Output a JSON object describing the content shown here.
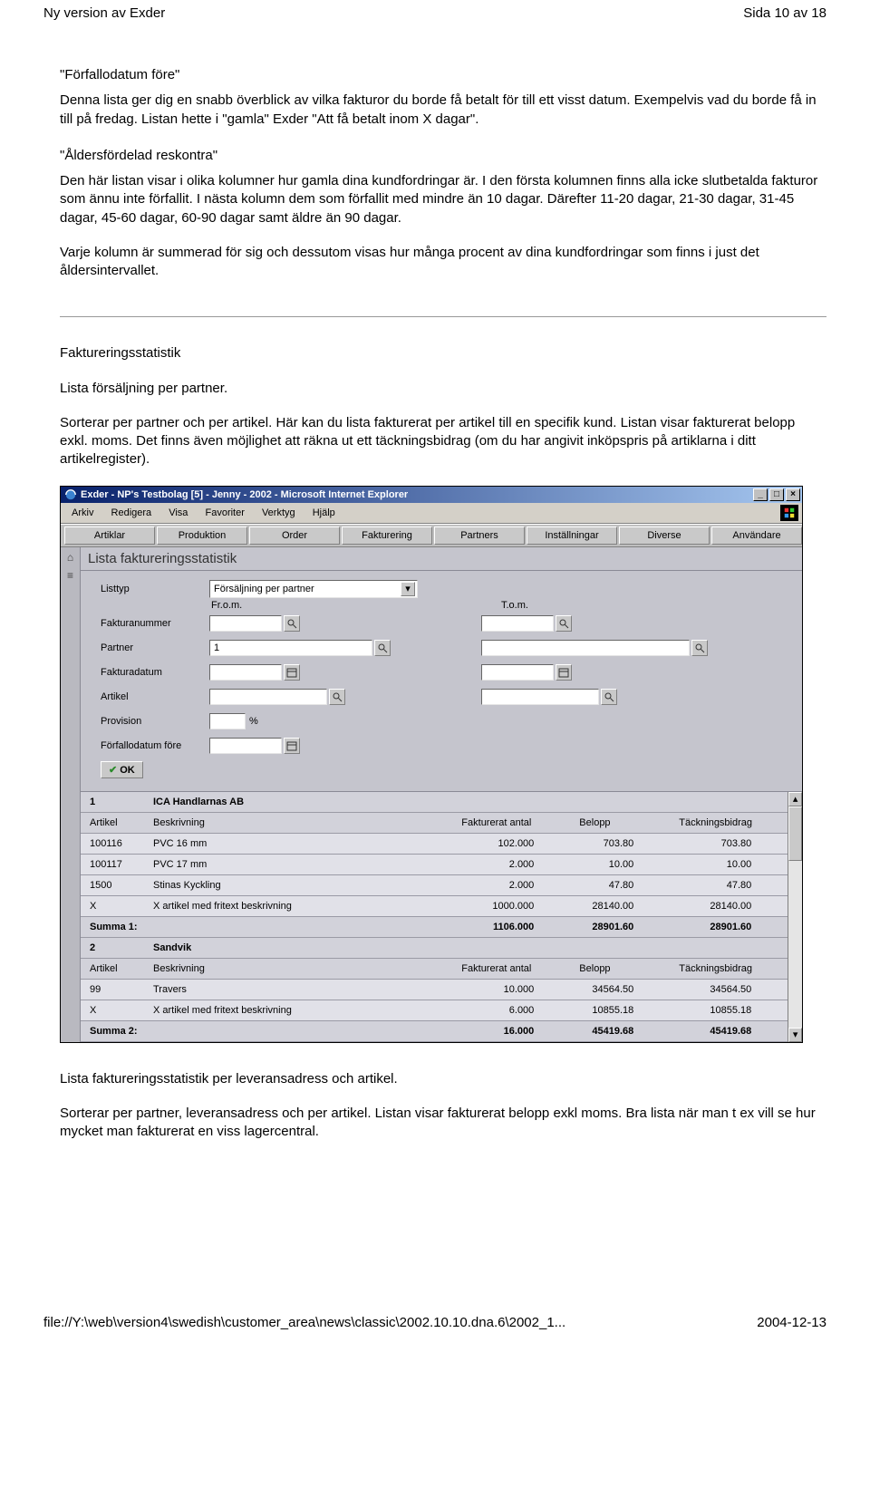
{
  "header": {
    "left": "Ny version av Exder",
    "right": "Sida 10 av 18"
  },
  "body": {
    "h1": "\"Förfallodatum före\"",
    "p1": "Denna lista ger dig en snabb överblick av vilka fakturor du borde få betalt för till ett visst datum. Exempelvis vad du borde få in till på fredag. Listan hette i \"gamla\" Exder \"Att få betalt inom X dagar\".",
    "h2": "\"Åldersfördelad reskontra\"",
    "p2": "Den här listan visar i olika kolumner hur gamla dina kundfordringar är. I den första kolumnen finns alla icke slutbetalda fakturor som ännu inte förfallit. I nästa kolumn dem som förfallit med mindre än 10 dagar. Därefter 11-20 dagar, 21-30 dagar, 31-45 dagar, 45-60 dagar, 60-90 dagar samt äldre än 90 dagar.",
    "p3": "Varje kolumn är summerad för sig och dessutom visas hur många procent av dina kundfordringar som finns i just det åldersintervallet.",
    "h3": "Faktureringsstatistik",
    "p4": "Lista försäljning per partner.",
    "p5": "Sorterar per partner och per artikel. Här kan du lista fakturerat per artikel till en specifik kund. Listan visar fakturerat belopp exkl. moms. Det finns även möjlighet att räkna ut ett täckningsbidrag (om du har angivit inköpspris på artiklarna i ditt artikelregister).",
    "p6": "Lista faktureringsstatistik per leveransadress och artikel.",
    "p7": "Sorterar per partner, leveransadress och per artikel. Listan visar fakturerat belopp exkl moms. Bra lista när man t ex vill se hur mycket man fakturerat en viss lagercentral."
  },
  "ie": {
    "title": "Exder - NP's Testbolag [5] - Jenny - 2002 - Microsoft Internet Explorer",
    "menus": [
      "Arkiv",
      "Redigera",
      "Visa",
      "Favoriter",
      "Verktyg",
      "Hjälp"
    ],
    "tabs": [
      "Artiklar",
      "Produktion",
      "Order",
      "Fakturering",
      "Partners",
      "Inställningar",
      "Diverse",
      "Användare"
    ],
    "page_title": "Lista faktureringsstatistik",
    "form": {
      "listtyp_label": "Listtyp",
      "listtyp_value": "Försäljning per partner",
      "from": "Fr.o.m.",
      "to": "T.o.m.",
      "fakturanummer": "Fakturanummer",
      "partner": "Partner",
      "partner_value": "1",
      "fakturadatum": "Fakturadatum",
      "artikel": "Artikel",
      "provision": "Provision",
      "provision_unit": "%",
      "forfallo": "Förfallodatum före",
      "ok": "OK"
    },
    "cols": {
      "artikel": "Artikel",
      "beskrivning": "Beskrivning",
      "antal": "Fakturerat antal",
      "belopp": "Belopp",
      "tackning": "Täckningsbidrag"
    },
    "groups": [
      {
        "id": "1",
        "name": "ICA Handlarnas AB",
        "rows": [
          {
            "a": "100116",
            "b": "PVC 16 mm",
            "c": "102.000",
            "d": "703.80",
            "e": "703.80"
          },
          {
            "a": "100117",
            "b": "PVC 17 mm",
            "c": "2.000",
            "d": "10.00",
            "e": "10.00"
          },
          {
            "a": "1500",
            "b": "Stinas Kyckling",
            "c": "2.000",
            "d": "47.80",
            "e": "47.80"
          },
          {
            "a": "X",
            "b": "X artikel med fritext beskrivning",
            "c": "1000.000",
            "d": "28140.00",
            "e": "28140.00"
          }
        ],
        "sum_label": "Summa 1:",
        "sum": {
          "c": "1106.000",
          "d": "28901.60",
          "e": "28901.60"
        }
      },
      {
        "id": "2",
        "name": "Sandvik",
        "rows": [
          {
            "a": "99",
            "b": "Travers",
            "c": "10.000",
            "d": "34564.50",
            "e": "34564.50"
          },
          {
            "a": "X",
            "b": "X artikel med fritext beskrivning",
            "c": "6.000",
            "d": "10855.18",
            "e": "10855.18"
          }
        ],
        "sum_label": "Summa 2:",
        "sum": {
          "c": "16.000",
          "d": "45419.68",
          "e": "45419.68"
        }
      }
    ]
  },
  "footer": {
    "path": "file://Y:\\web\\version4\\swedish\\customer_area\\news\\classic\\2002.10.10.dna.6\\2002_1...",
    "date": "2004-12-13"
  }
}
